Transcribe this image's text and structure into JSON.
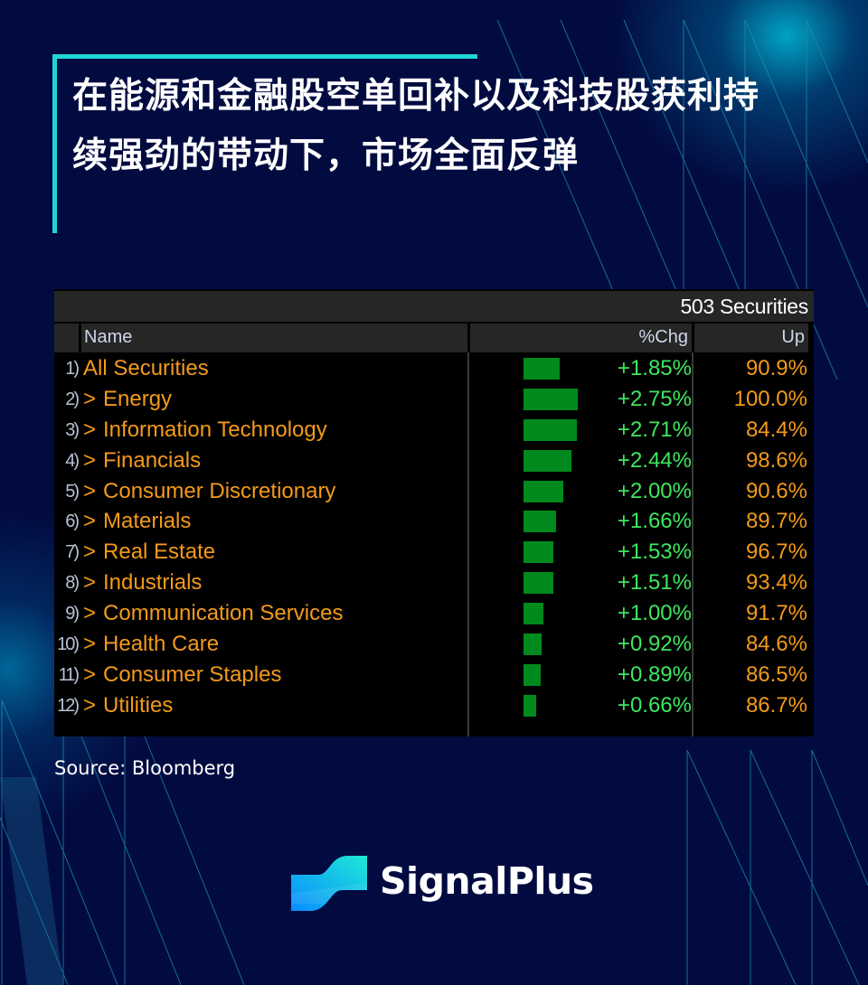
{
  "headline": "在能源和金融股空单回补以及科技股获利持续强劲的带动下，市场全面反弹",
  "colors": {
    "background": "#020b40",
    "accent": "#1fd6d6",
    "name_text": "#f39a1b",
    "chg_text": "#3ee65e",
    "bar": "#008a1e"
  },
  "table": {
    "securities_count": "503 Securities",
    "columns": {
      "name": "Name",
      "chg": "%Chg",
      "up": "Up"
    },
    "rows": [
      {
        "num": "1)",
        "name": "All Securities",
        "expand": false,
        "chg": "+1.85%",
        "chg_value": 1.85,
        "up": "90.9%"
      },
      {
        "num": "2)",
        "name": "Energy",
        "expand": true,
        "chg": "+2.75%",
        "chg_value": 2.75,
        "up": "100.0%"
      },
      {
        "num": "3)",
        "name": "Information Technology",
        "expand": true,
        "chg": "+2.71%",
        "chg_value": 2.71,
        "up": "84.4%"
      },
      {
        "num": "4)",
        "name": "Financials",
        "expand": true,
        "chg": "+2.44%",
        "chg_value": 2.44,
        "up": "98.6%"
      },
      {
        "num": "5)",
        "name": "Consumer Discretionary",
        "expand": true,
        "chg": "+2.00%",
        "chg_value": 2.0,
        "up": "90.6%"
      },
      {
        "num": "6)",
        "name": "Materials",
        "expand": true,
        "chg": "+1.66%",
        "chg_value": 1.66,
        "up": "89.7%"
      },
      {
        "num": "7)",
        "name": "Real Estate",
        "expand": true,
        "chg": "+1.53%",
        "chg_value": 1.53,
        "up": "96.7%"
      },
      {
        "num": "8)",
        "name": "Industrials",
        "expand": true,
        "chg": "+1.51%",
        "chg_value": 1.51,
        "up": "93.4%"
      },
      {
        "num": "9)",
        "name": "Communication Services",
        "expand": true,
        "chg": "+1.00%",
        "chg_value": 1.0,
        "up": "91.7%"
      },
      {
        "num": "10)",
        "name": "Health Care",
        "expand": true,
        "chg": "+0.92%",
        "chg_value": 0.92,
        "up": "84.6%"
      },
      {
        "num": "11)",
        "name": "Consumer Staples",
        "expand": true,
        "chg": "+0.89%",
        "chg_value": 0.89,
        "up": "86.5%"
      },
      {
        "num": "12)",
        "name": "Utilities",
        "expand": true,
        "chg": "+0.66%",
        "chg_value": 0.66,
        "up": "86.7%"
      }
    ]
  },
  "source": "Source: Bloomberg",
  "brand": {
    "name": "SignalPlus",
    "logo_icon": "signalplus-logo-icon"
  }
}
